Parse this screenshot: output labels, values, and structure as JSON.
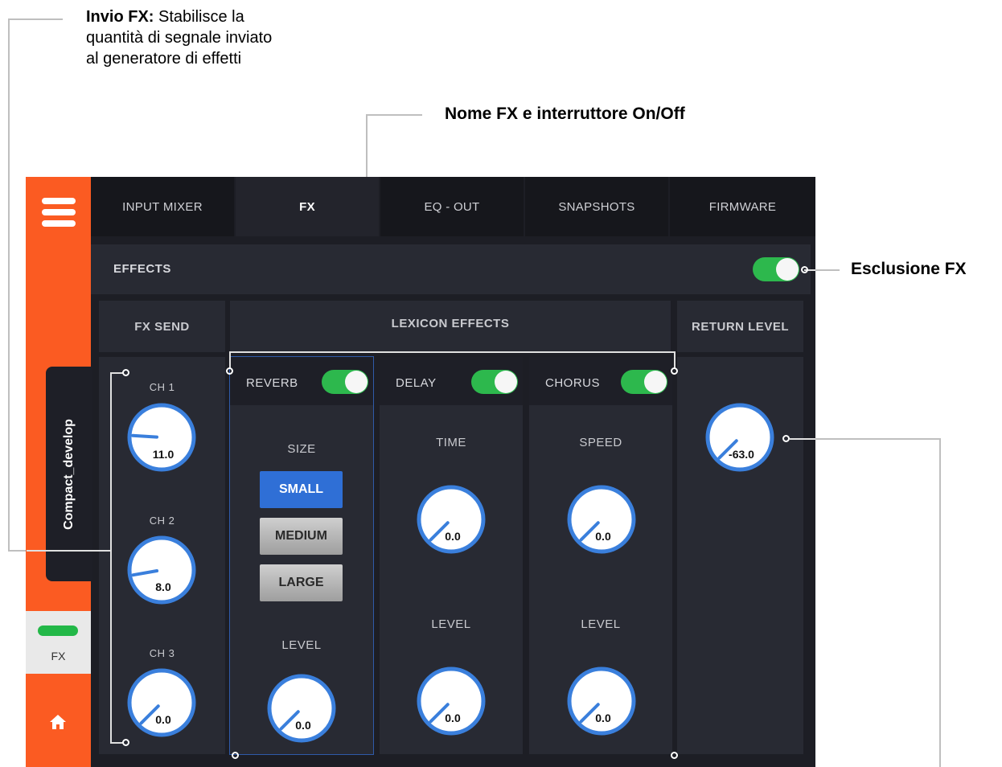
{
  "annotations": {
    "fx_send_title": "Invio FX:",
    "fx_send_desc_1": "Stabilisce la",
    "fx_send_desc_2": "quantità di segnale inviato",
    "fx_send_desc_3": "al generatore di effetti",
    "fx_name_switch": "Nome FX e interruttore On/Off",
    "fx_bypass": "Esclusione FX"
  },
  "sidebar": {
    "device_name": "Compact_develop",
    "fx_tab_label": "FX",
    "menu_icon": "hamburger-icon",
    "home_icon": "home-icon"
  },
  "tabs": [
    {
      "label": "INPUT MIXER"
    },
    {
      "label": "FX"
    },
    {
      "label": "EQ - OUT"
    },
    {
      "label": "SNAPSHOTS"
    },
    {
      "label": "FIRMWARE"
    }
  ],
  "effects": {
    "title": "EFFECTS",
    "enabled": true
  },
  "fx_send": {
    "title": "FX SEND",
    "channels": [
      {
        "label": "CH 1",
        "value": "11.0",
        "level": 0.18
      },
      {
        "label": "CH 2",
        "value": "8.0",
        "level": 0.13
      },
      {
        "label": "CH 3",
        "value": "0.0",
        "level": 0.0
      }
    ]
  },
  "lexicon": {
    "title": "LEXICON EFFECTS",
    "reverb": {
      "name": "REVERB",
      "on": true,
      "size_label": "SIZE",
      "sizes": [
        "SMALL",
        "MEDIUM",
        "LARGE"
      ],
      "selected": "SMALL",
      "level_label": "LEVEL",
      "level_value": "0.0"
    },
    "delay": {
      "name": "DELAY",
      "on": true,
      "time_label": "TIME",
      "time_value": "0.0",
      "level_label": "LEVEL",
      "level_value": "0.0"
    },
    "chorus": {
      "name": "CHORUS",
      "on": true,
      "speed_label": "SPEED",
      "speed_value": "0.0",
      "level_label": "LEVEL",
      "level_value": "0.0"
    }
  },
  "return_level": {
    "title": "RETURN LEVEL",
    "value": "-63.0",
    "level": 0.0
  },
  "colors": {
    "accent_orange": "#fb5b22",
    "toggle_green": "#2db84d",
    "knob_blue": "#3a7fdc",
    "selected_blue": "#2f6fd6"
  }
}
